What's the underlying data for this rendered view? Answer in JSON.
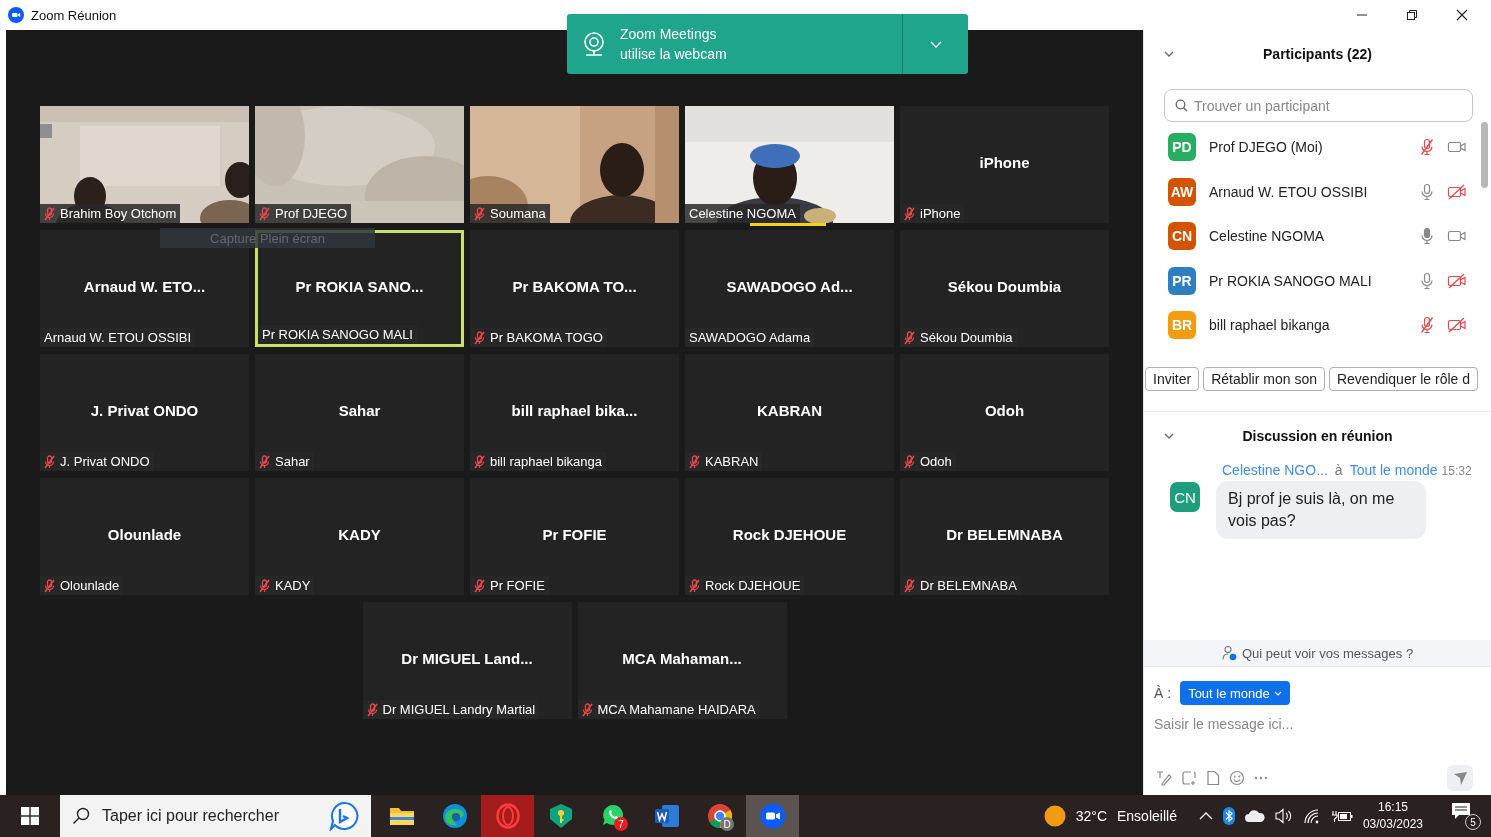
{
  "window": {
    "title": "Zoom Réunion"
  },
  "toast": {
    "title": "Zoom Meetings",
    "message": "utilise la webcam"
  },
  "tooltip": {
    "text": "Capture Plein écran"
  },
  "tiles": [
    {
      "kind": "video",
      "label": "Brahim Boy Otchom",
      "muted": true,
      "highlighted": false,
      "speaking": false
    },
    {
      "kind": "video",
      "label": "Prof DJEGO",
      "muted": true,
      "highlighted": false,
      "speaking": false
    },
    {
      "kind": "video",
      "label": "Soumana",
      "muted": true,
      "highlighted": false,
      "speaking": false
    },
    {
      "kind": "video",
      "label": "Celestine NGOMA",
      "muted": false,
      "highlighted": false,
      "speaking": true
    },
    {
      "kind": "name",
      "title": "iPhone",
      "label": "iPhone",
      "muted": true,
      "highlighted": false,
      "speaking": false
    },
    {
      "kind": "name",
      "title": "Arnaud W. ETO...",
      "label": "Arnaud W. ETOU OSSIBI",
      "muted": false,
      "highlighted": false,
      "speaking": false
    },
    {
      "kind": "name",
      "title": "Pr ROKIA SANO...",
      "label": "Pr ROKIA SANOGO MALI",
      "muted": false,
      "highlighted": true,
      "speaking": false
    },
    {
      "kind": "name",
      "title": "Pr BAKOMA TO...",
      "label": "Pr BAKOMA TOGO",
      "muted": true,
      "highlighted": false,
      "speaking": false
    },
    {
      "kind": "name",
      "title": "SAWADOGO Ad...",
      "label": "SAWADOGO Adama",
      "muted": false,
      "highlighted": false,
      "speaking": false
    },
    {
      "kind": "name",
      "title": "Sékou Doumbia",
      "label": "Sékou Doumbia",
      "muted": true,
      "highlighted": false,
      "speaking": false
    },
    {
      "kind": "name",
      "title": "J. Privat ONDO",
      "label": "J. Privat ONDO",
      "muted": true,
      "highlighted": false,
      "speaking": false
    },
    {
      "kind": "name",
      "title": "Sahar",
      "label": "Sahar",
      "muted": true,
      "highlighted": false,
      "speaking": false
    },
    {
      "kind": "name",
      "title": "bill raphael bika...",
      "label": "bill raphael bikanga",
      "muted": true,
      "highlighted": false,
      "speaking": false
    },
    {
      "kind": "name",
      "title": "KABRAN",
      "label": "KABRAN",
      "muted": true,
      "highlighted": false,
      "speaking": false
    },
    {
      "kind": "name",
      "title": "Odoh",
      "label": "Odoh",
      "muted": true,
      "highlighted": false,
      "speaking": false
    },
    {
      "kind": "name",
      "title": "Olounlade",
      "label": "Olounlade",
      "muted": true,
      "highlighted": false,
      "speaking": false
    },
    {
      "kind": "name",
      "title": "KADY",
      "label": "KADY",
      "muted": true,
      "highlighted": false,
      "speaking": false
    },
    {
      "kind": "name",
      "title": "Pr FOFIE",
      "label": "Pr FOFIE",
      "muted": true,
      "highlighted": false,
      "speaking": false
    },
    {
      "kind": "name",
      "title": "Rock DJEHOUE",
      "label": "Rock DJEHOUE",
      "muted": true,
      "highlighted": false,
      "speaking": false
    },
    {
      "kind": "name",
      "title": "Dr BELEMNABA",
      "label": "Dr BELEMNABA",
      "muted": true,
      "highlighted": false,
      "speaking": false
    },
    {
      "kind": "name",
      "title": "Dr MIGUEL Land...",
      "label": "Dr MIGUEL Landry Martial",
      "muted": true,
      "highlighted": false,
      "speaking": false
    },
    {
      "kind": "name",
      "title": "MCA Mahaman...",
      "label": "MCA Mahamane HAIDARA",
      "muted": true,
      "highlighted": false,
      "speaking": false
    }
  ],
  "participants": {
    "title": "Participants (22)",
    "search_placeholder": "Trouver un participant",
    "items": [
      {
        "initials": "PD",
        "name": "Prof DJEGO (Moi)",
        "color": "#27ae60",
        "muted": true,
        "speaking": false,
        "video_off": false
      },
      {
        "initials": "AW",
        "name": "Arnaud W. ETOU OSSIBI",
        "color": "#d35400",
        "muted": false,
        "speaking": false,
        "video_off": true
      },
      {
        "initials": "CN",
        "name": "Celestine NGOMA",
        "color": "#d35400",
        "muted": false,
        "speaking": true,
        "video_off": false
      },
      {
        "initials": "PR",
        "name": "Pr ROKIA SANOGO MALI",
        "color": "#2e7fc1",
        "muted": false,
        "speaking": false,
        "video_off": true
      },
      {
        "initials": "BR",
        "name": "bill raphael bikanga",
        "color": "#f39c12",
        "muted": true,
        "speaking": false,
        "video_off": true
      }
    ],
    "buttons": [
      "Inviter",
      "Rétablir mon son",
      "Revendiquer le rôle d"
    ]
  },
  "chat": {
    "title": "Discussion en réunion",
    "messages": [
      {
        "sender": "Celestine NGO...",
        "to": "à",
        "recipient": "Tout le monde",
        "time": "15:32",
        "initials": "CN",
        "color": "#1e9e7c",
        "text": "Bj prof je suis là, on me vois pas?"
      }
    ],
    "privacy": "Qui peut voir vos messages ?",
    "to_label": "À :",
    "recipient_button": "Tout le monde",
    "placeholder": "Saisir le message ici..."
  },
  "taskbar": {
    "search_placeholder": "Taper ici pour rechercher",
    "apps": [
      {
        "kind": "folder",
        "hovered": false,
        "active": false
      },
      {
        "kind": "edge",
        "hovered": false,
        "active": false
      },
      {
        "kind": "opera",
        "hovered": true,
        "active": false
      },
      {
        "kind": "shield",
        "hovered": false,
        "active": false
      },
      {
        "kind": "whatsapp",
        "hovered": false,
        "active": false,
        "badge": "7"
      },
      {
        "kind": "word",
        "hovered": false,
        "active": false
      },
      {
        "kind": "chrome",
        "hovered": false,
        "active": false,
        "badge": "D"
      },
      {
        "kind": "zoom",
        "hovered": false,
        "active": true
      }
    ],
    "temperature": "32°C",
    "weather": "Ensoleillé",
    "time": "16:15",
    "date": "03/03/2023",
    "notifications": "5"
  }
}
